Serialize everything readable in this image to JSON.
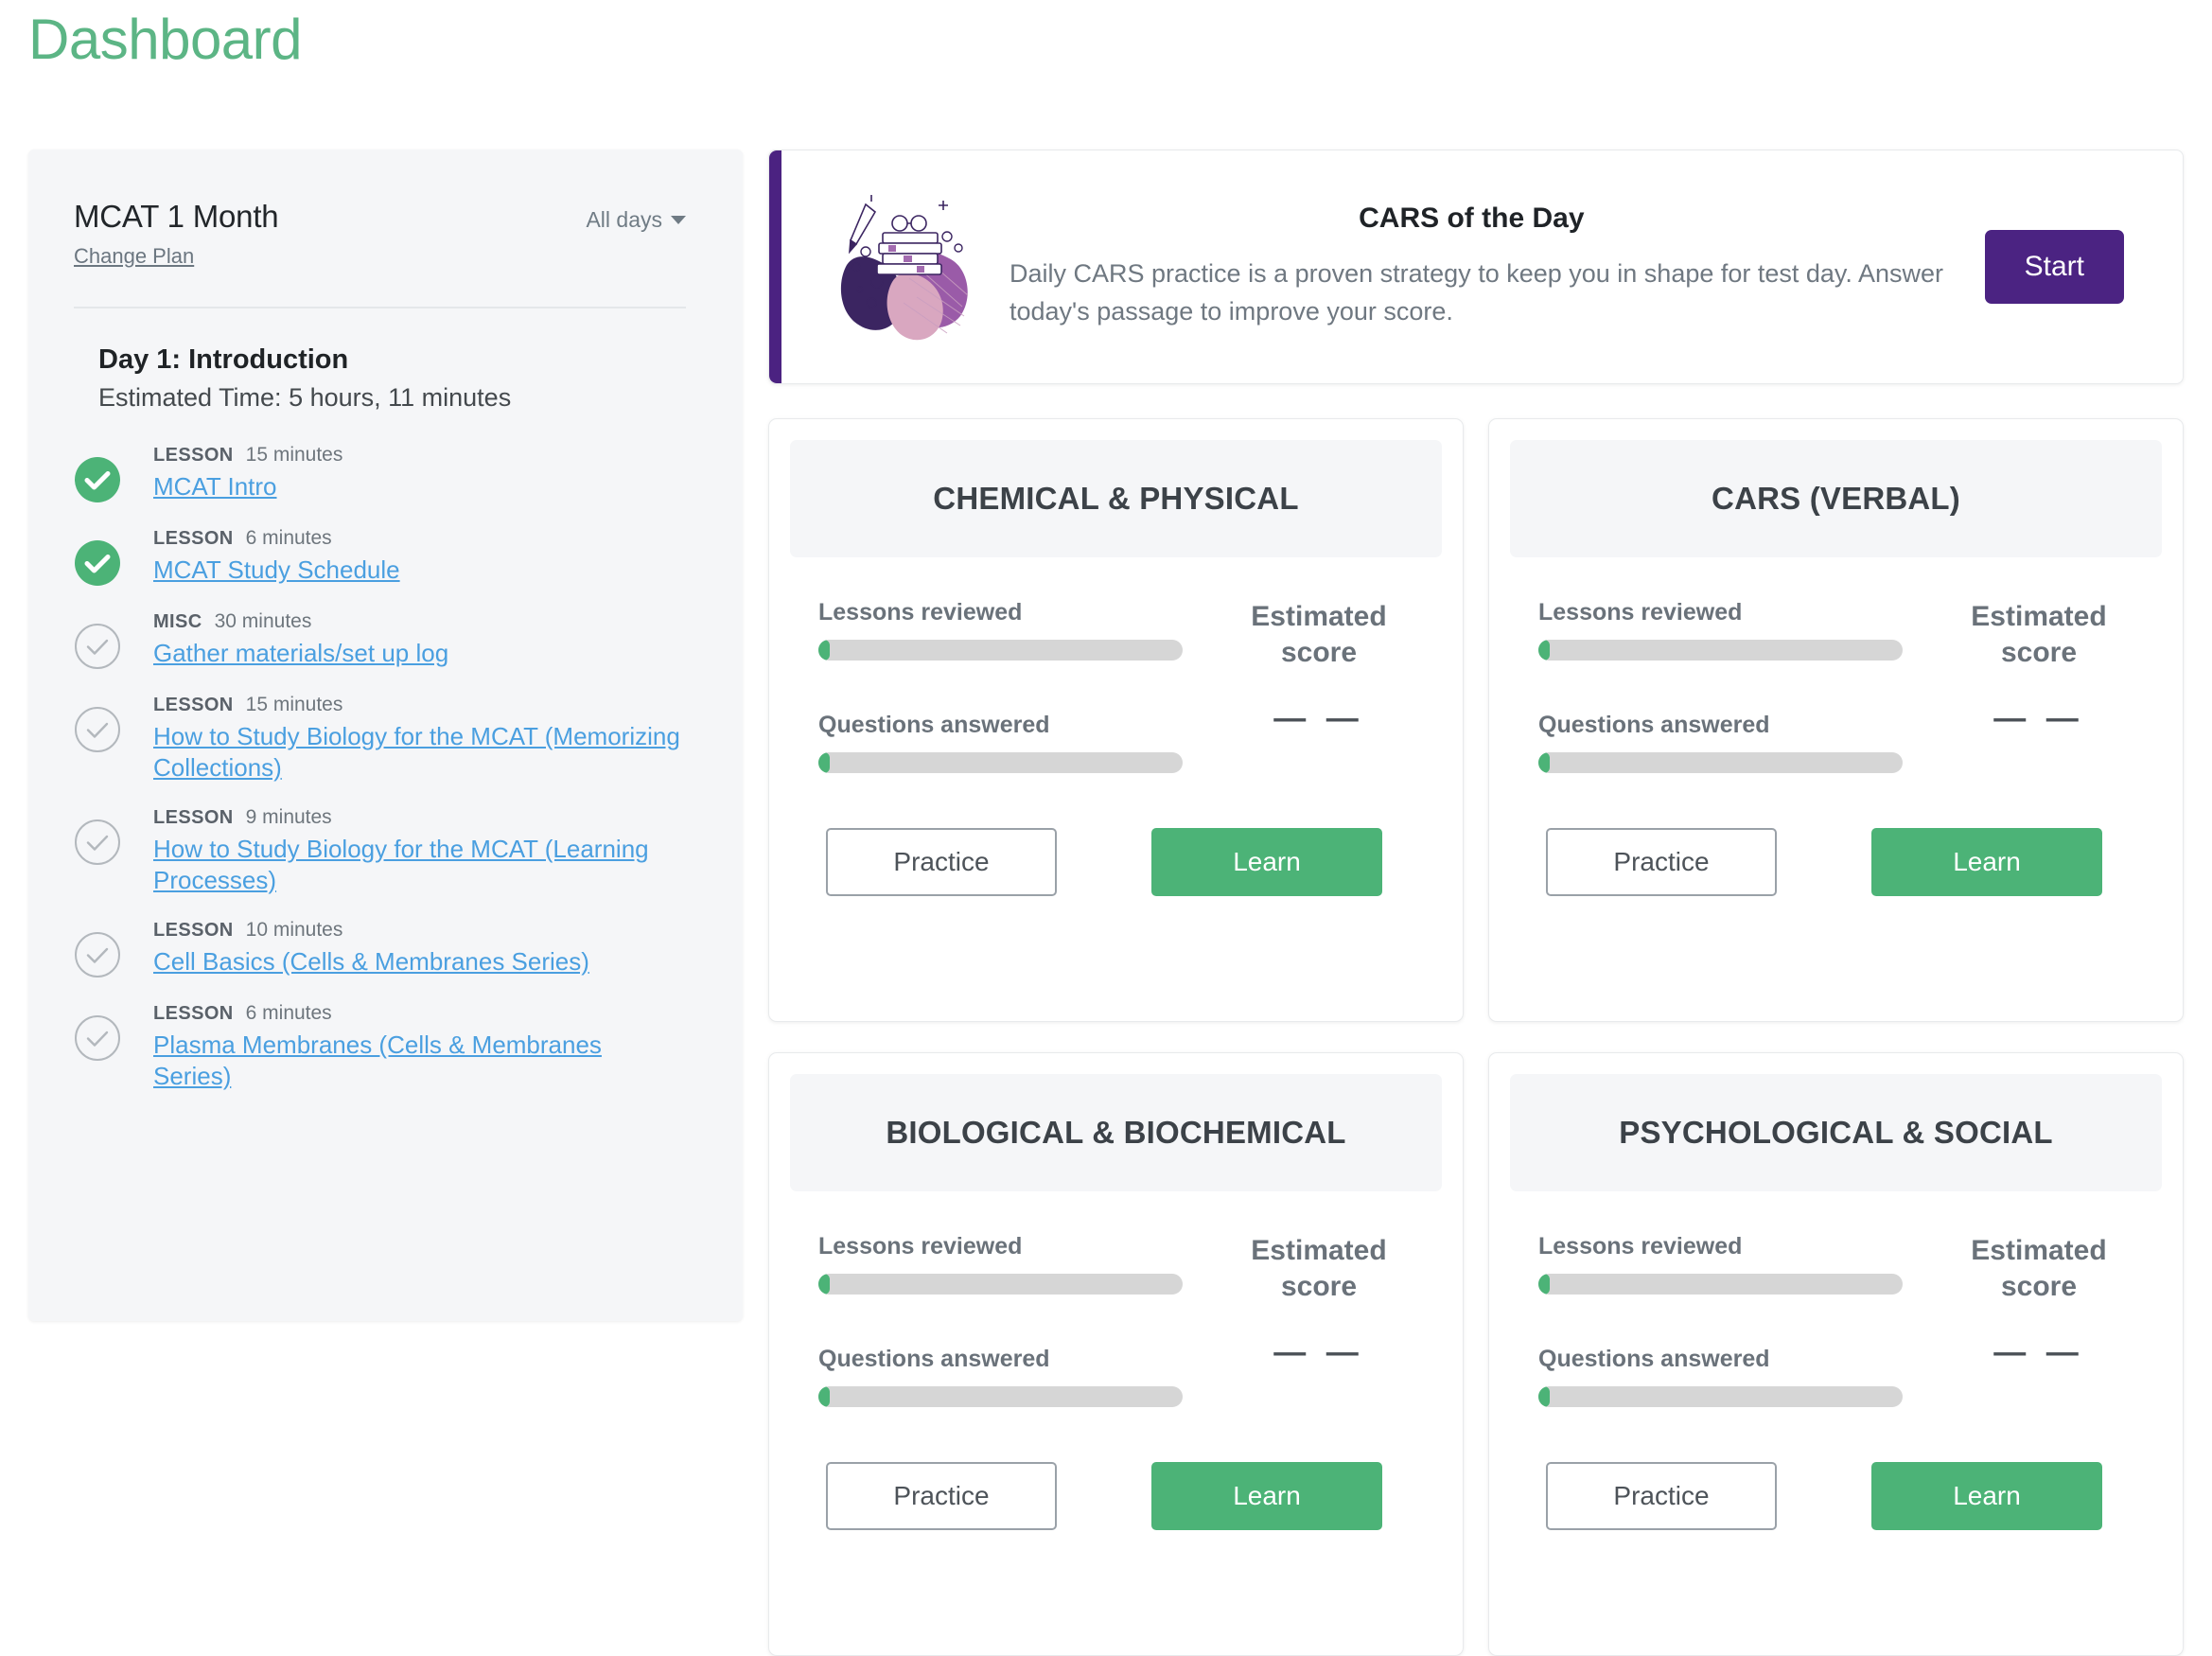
{
  "page": {
    "title": "Dashboard",
    "title_color": "#5cb585"
  },
  "sidebar": {
    "plan_name": "MCAT 1 Month",
    "change_plan_label": "Change Plan",
    "filter_label": "All days",
    "day_title": "Day 1: Introduction",
    "estimated_time": "Estimated Time: 5 hours, 11 minutes",
    "tasks": [
      {
        "kind": "LESSON",
        "duration": "15 minutes",
        "title": "MCAT Intro",
        "completed": true
      },
      {
        "kind": "LESSON",
        "duration": "6 minutes",
        "title": "MCAT Study Schedule",
        "completed": true
      },
      {
        "kind": "MISC",
        "duration": "30 minutes",
        "title": "Gather materials/set up log",
        "completed": false
      },
      {
        "kind": "LESSON",
        "duration": "15 minutes",
        "title": "How to Study Biology for the MCAT (Memorizing Collections)",
        "completed": false
      },
      {
        "kind": "LESSON",
        "duration": "9 minutes",
        "title": "How to Study Biology for the MCAT (Learning Processes)",
        "completed": false
      },
      {
        "kind": "LESSON",
        "duration": "10 minutes",
        "title": "Cell Basics (Cells & Membranes Series)",
        "completed": false
      },
      {
        "kind": "LESSON",
        "duration": "6 minutes",
        "title": "Plasma Membranes (Cells & Membranes Series)",
        "completed": false
      }
    ]
  },
  "banner": {
    "title": "CARS of the Day",
    "description": "Daily CARS practice is a proven strategy to keep you in shape for test day. Answer today's passage to improve your score.",
    "button_label": "Start",
    "accent_color": "#4b2281",
    "button_color": "#4b2382",
    "illustration": "books-stack-illustration"
  },
  "subject_cards": [
    {
      "name": "CHEMICAL & PHYSICAL",
      "lessons_label": "Lessons reviewed",
      "lessons_percent": 3,
      "questions_label": "Questions answered",
      "questions_percent": 3,
      "score_title": "Estimated score",
      "score_value": "— —",
      "practice_label": "Practice",
      "learn_label": "Learn"
    },
    {
      "name": "CARS (VERBAL)",
      "lessons_label": "Lessons reviewed",
      "lessons_percent": 3,
      "questions_label": "Questions answered",
      "questions_percent": 3,
      "score_title": "Estimated score",
      "score_value": "— —",
      "practice_label": "Practice",
      "learn_label": "Learn"
    },
    {
      "name": "BIOLOGICAL & BIOCHEMICAL",
      "lessons_label": "Lessons reviewed",
      "lessons_percent": 3,
      "questions_label": "Questions answered",
      "questions_percent": 3,
      "score_title": "Estimated score",
      "score_value": "— —",
      "practice_label": "Practice",
      "learn_label": "Learn"
    },
    {
      "name": "PSYCHOLOGICAL & SOCIAL",
      "lessons_label": "Lessons reviewed",
      "lessons_percent": 3,
      "questions_label": "Questions answered",
      "questions_percent": 3,
      "score_title": "Estimated score",
      "score_value": "— —",
      "practice_label": "Practice",
      "learn_label": "Learn"
    }
  ],
  "colors": {
    "brand_green": "#4cb377",
    "title_green": "#5cb585",
    "link_blue": "#4a9fe0",
    "purple": "#4b2382",
    "sidebar_bg": "#f5f6f8"
  }
}
